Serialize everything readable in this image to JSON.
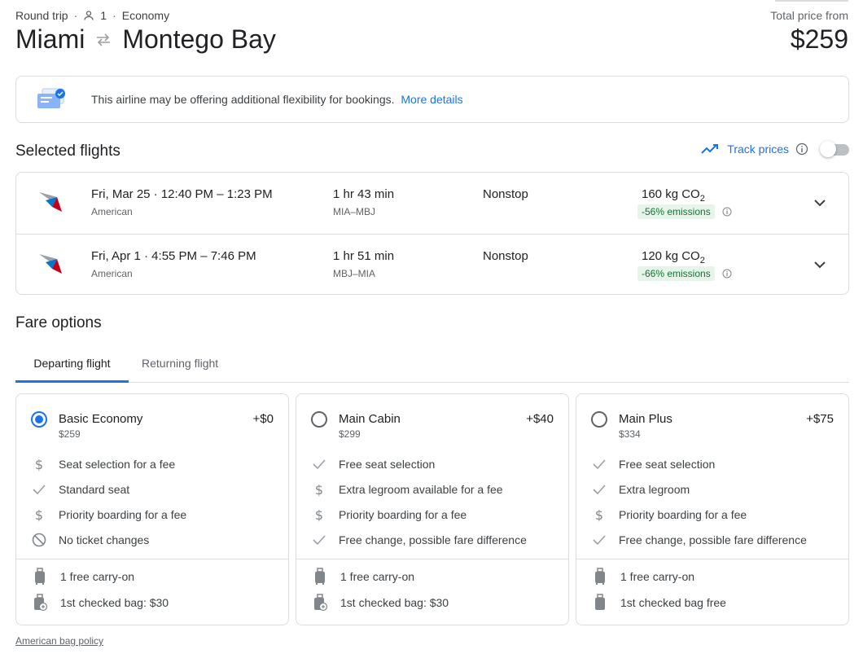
{
  "header": {
    "trip_type": "Round trip",
    "passengers": "1",
    "cabin": "Economy",
    "origin": "Miami",
    "destination": "Montego Bay",
    "price_label": "Total price from",
    "price": "$259"
  },
  "banner": {
    "text": "This airline may be offering additional flexibility for bookings.",
    "link": "More details"
  },
  "selected": {
    "title": "Selected flights",
    "track_label": "Track prices",
    "track_enabled": false,
    "flights": [
      {
        "date_time": "Fri, Mar 25 · 12:40 PM – 1:23 PM",
        "airline": "American",
        "duration": "1 hr 43 min",
        "route": "MIA–MBJ",
        "stops": "Nonstop",
        "co2": "160 kg CO",
        "co2_sub": "2",
        "emissions": "-56% emissions"
      },
      {
        "date_time": "Fri, Apr 1 · 4:55 PM – 7:46 PM",
        "airline": "American",
        "duration": "1 hr 51 min",
        "route": "MBJ–MIA",
        "stops": "Nonstop",
        "co2": "120 kg CO",
        "co2_sub": "2",
        "emissions": "-66% emissions"
      }
    ]
  },
  "fares": {
    "title": "Fare options",
    "tabs": [
      "Departing flight",
      "Returning flight"
    ],
    "cards": [
      {
        "name": "Basic Economy",
        "total": "$259",
        "delta": "+$0",
        "selected": true,
        "features": [
          {
            "icon": "dollar-icon",
            "text": "Seat selection for a fee"
          },
          {
            "icon": "check-icon",
            "text": "Standard seat"
          },
          {
            "icon": "dollar-icon",
            "text": "Priority boarding for a fee"
          },
          {
            "icon": "no-icon",
            "text": "No ticket changes"
          }
        ],
        "bags": [
          {
            "icon": "carry-on-icon",
            "text": "1 free carry-on"
          },
          {
            "icon": "checked-bag-fee-icon",
            "text": "1st checked bag: $30"
          }
        ]
      },
      {
        "name": "Main Cabin",
        "total": "$299",
        "delta": "+$40",
        "selected": false,
        "features": [
          {
            "icon": "check-icon",
            "text": "Free seat selection"
          },
          {
            "icon": "dollar-icon",
            "text": "Extra legroom available for a fee"
          },
          {
            "icon": "dollar-icon",
            "text": "Priority boarding for a fee"
          },
          {
            "icon": "check-icon",
            "text": "Free change, possible fare difference"
          }
        ],
        "bags": [
          {
            "icon": "carry-on-icon",
            "text": "1 free carry-on"
          },
          {
            "icon": "checked-bag-fee-icon",
            "text": "1st checked bag: $30"
          }
        ]
      },
      {
        "name": "Main Plus",
        "total": "$334",
        "delta": "+$75",
        "selected": false,
        "features": [
          {
            "icon": "check-icon",
            "text": "Free seat selection"
          },
          {
            "icon": "check-icon",
            "text": "Extra legroom"
          },
          {
            "icon": "dollar-icon",
            "text": "Priority boarding for a fee"
          },
          {
            "icon": "check-icon",
            "text": "Free change, possible fare difference"
          }
        ],
        "bags": [
          {
            "icon": "carry-on-icon",
            "text": "1 free carry-on"
          },
          {
            "icon": "checked-bag-icon",
            "text": "1st checked bag free"
          }
        ]
      }
    ]
  },
  "footer": {
    "bag_policy": "American bag policy"
  },
  "colors": {
    "accent": "#1a73e8",
    "emission_bg": "#e6f4ea",
    "emission_text": "#137333",
    "airline_red": "#c30019",
    "airline_blue": "#0078d2"
  }
}
